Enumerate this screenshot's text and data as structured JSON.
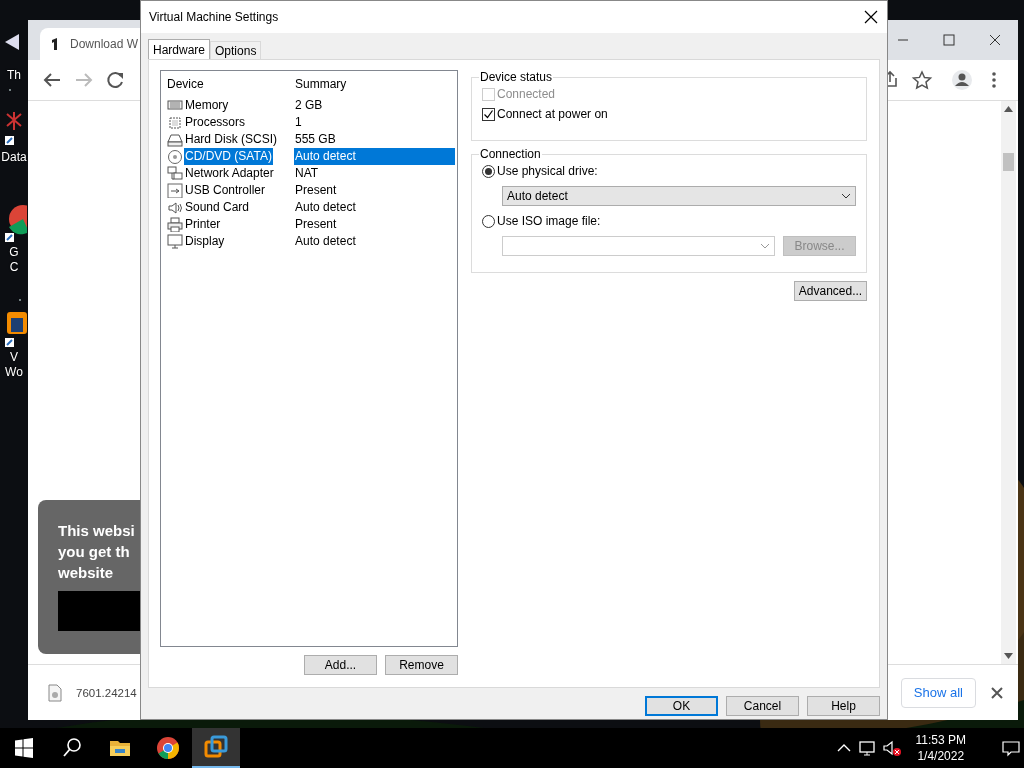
{
  "desktop": {
    "icons": [
      {
        "kind": "arrow",
        "lines": [
          "Th"
        ]
      },
      {
        "kind": "network",
        "lines": [
          "Data"
        ]
      },
      {
        "kind": "chrome",
        "lines": [
          "G",
          "C"
        ]
      },
      {
        "kind": "vmware",
        "lines": [
          "V",
          "Wo"
        ]
      }
    ]
  },
  "browser": {
    "tab": {
      "title": "Download W"
    },
    "cookie_notice": {
      "lines": [
        "This websi",
        "you get th",
        "website"
      ]
    },
    "download": {
      "file": "7601.24214",
      "show_all": "Show all"
    }
  },
  "dialog": {
    "title": "Virtual Machine Settings",
    "tabs": [
      {
        "label": "Hardware",
        "selected": true
      },
      {
        "label": "Options",
        "selected": false
      }
    ],
    "device_list": {
      "columns": [
        "Device",
        "Summary"
      ],
      "rows": [
        {
          "kind": "memory",
          "device": "Memory",
          "summary": "2 GB",
          "selected": false
        },
        {
          "kind": "processor",
          "device": "Processors",
          "summary": "1",
          "selected": false
        },
        {
          "kind": "disk",
          "device": "Hard Disk (SCSI)",
          "summary": "555 GB",
          "selected": false
        },
        {
          "kind": "cdrom",
          "device": "CD/DVD (SATA)",
          "summary": "Auto detect",
          "selected": true
        },
        {
          "kind": "network",
          "device": "Network Adapter",
          "summary": "NAT",
          "selected": false
        },
        {
          "kind": "usb",
          "device": "USB Controller",
          "summary": "Present",
          "selected": false
        },
        {
          "kind": "sound",
          "device": "Sound Card",
          "summary": "Auto detect",
          "selected": false
        },
        {
          "kind": "printer",
          "device": "Printer",
          "summary": "Present",
          "selected": false
        },
        {
          "kind": "display",
          "device": "Display",
          "summary": "Auto detect",
          "selected": false
        }
      ]
    },
    "list_buttons": [
      "Add...",
      "Remove"
    ],
    "device_status": {
      "title": "Device status",
      "options": [
        {
          "label": "Connected",
          "checked": false,
          "disabled": true
        },
        {
          "label": "Connect at power on",
          "checked": true,
          "disabled": false
        }
      ]
    },
    "connection": {
      "title": "Connection",
      "options": [
        {
          "label": "Use physical drive:",
          "selected": true
        },
        {
          "label": "Use ISO image file:",
          "selected": false
        }
      ],
      "drive": {
        "value": "Auto detect"
      },
      "browse": {
        "label": "Browse...",
        "disabled": true
      }
    },
    "advanced": "Advanced...",
    "buttons": [
      {
        "label": "OK",
        "default": true
      },
      {
        "label": "Cancel",
        "default": false
      },
      {
        "label": "Help",
        "default": false
      }
    ]
  },
  "taskbar": {
    "apps": [
      {
        "kind": "explorer",
        "active": false
      },
      {
        "kind": "chrome",
        "active": false
      },
      {
        "kind": "vmware",
        "active": true
      }
    ],
    "clock": {
      "time": "11:53 PM",
      "date": "1/4/2022"
    }
  }
}
